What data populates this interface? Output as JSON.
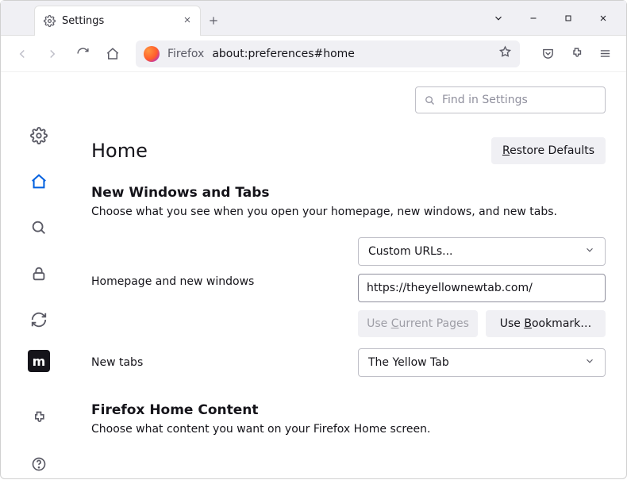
{
  "tab": {
    "title": "Settings"
  },
  "urlbar": {
    "brand": "Firefox",
    "url": "about:preferences#home"
  },
  "search": {
    "placeholder": "Find in Settings"
  },
  "page": {
    "title": "Home",
    "restore": "Restore Defaults",
    "section1_title": "New Windows and Tabs",
    "section1_desc": "Choose what you see when you open your homepage, new windows, and new tabs.",
    "homepage_label": "Homepage and new windows",
    "homepage_dropdown": "Custom URLs...",
    "homepage_url": "https://theyellownewtab.com/",
    "use_current": "Use Current Pages",
    "use_bookmark": "Use Bookmark…",
    "newtabs_label": "New tabs",
    "newtabs_dropdown": "The Yellow Tab",
    "section2_title": "Firefox Home Content",
    "section2_desc": "Choose what content you want on your Firefox Home screen."
  }
}
